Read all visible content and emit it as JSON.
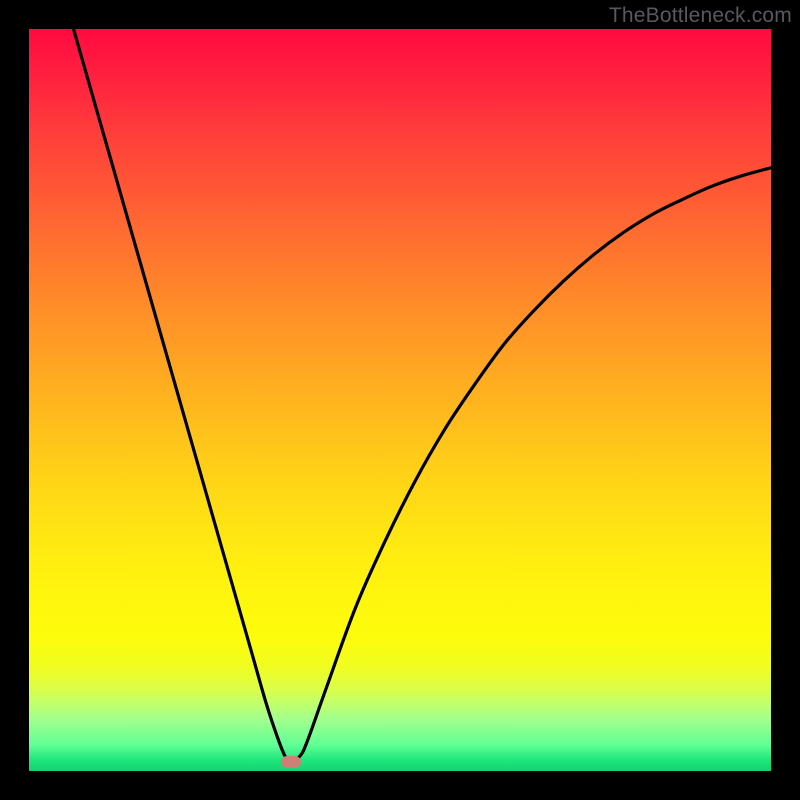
{
  "watermark": "TheBottleneck.com",
  "colors": {
    "frame": "#000000",
    "curve": "#000000",
    "marker": "#cf8076",
    "gradient_top": "#ff0a40",
    "gradient_bottom": "#13d173"
  },
  "chart_data": {
    "type": "line",
    "title": "",
    "xlabel": "",
    "ylabel": "",
    "xlim": [
      0,
      100
    ],
    "ylim": [
      0,
      100
    ],
    "grid": false,
    "series": [
      {
        "name": "bottleneck-curve",
        "x": [
          6,
          8,
          10,
          12,
          14,
          16,
          18,
          20,
          22,
          24,
          26,
          28,
          30,
          32,
          33.5,
          34.5,
          35.3,
          36.5,
          37.5,
          40,
          44,
          48,
          52,
          56,
          60,
          64,
          68,
          72,
          76,
          80,
          84,
          88,
          92,
          96,
          100
        ],
        "y": [
          100,
          93,
          86,
          79,
          72,
          65,
          58,
          51,
          44,
          37,
          30,
          23,
          16,
          9,
          4.5,
          2,
          1.2,
          2,
          4,
          11,
          22,
          31,
          39,
          46,
          52,
          57.5,
          62,
          66,
          69.5,
          72.5,
          75,
          77,
          78.8,
          80.2,
          81.3
        ]
      }
    ],
    "marker": {
      "x": 35.3,
      "y": 1.2
    }
  }
}
